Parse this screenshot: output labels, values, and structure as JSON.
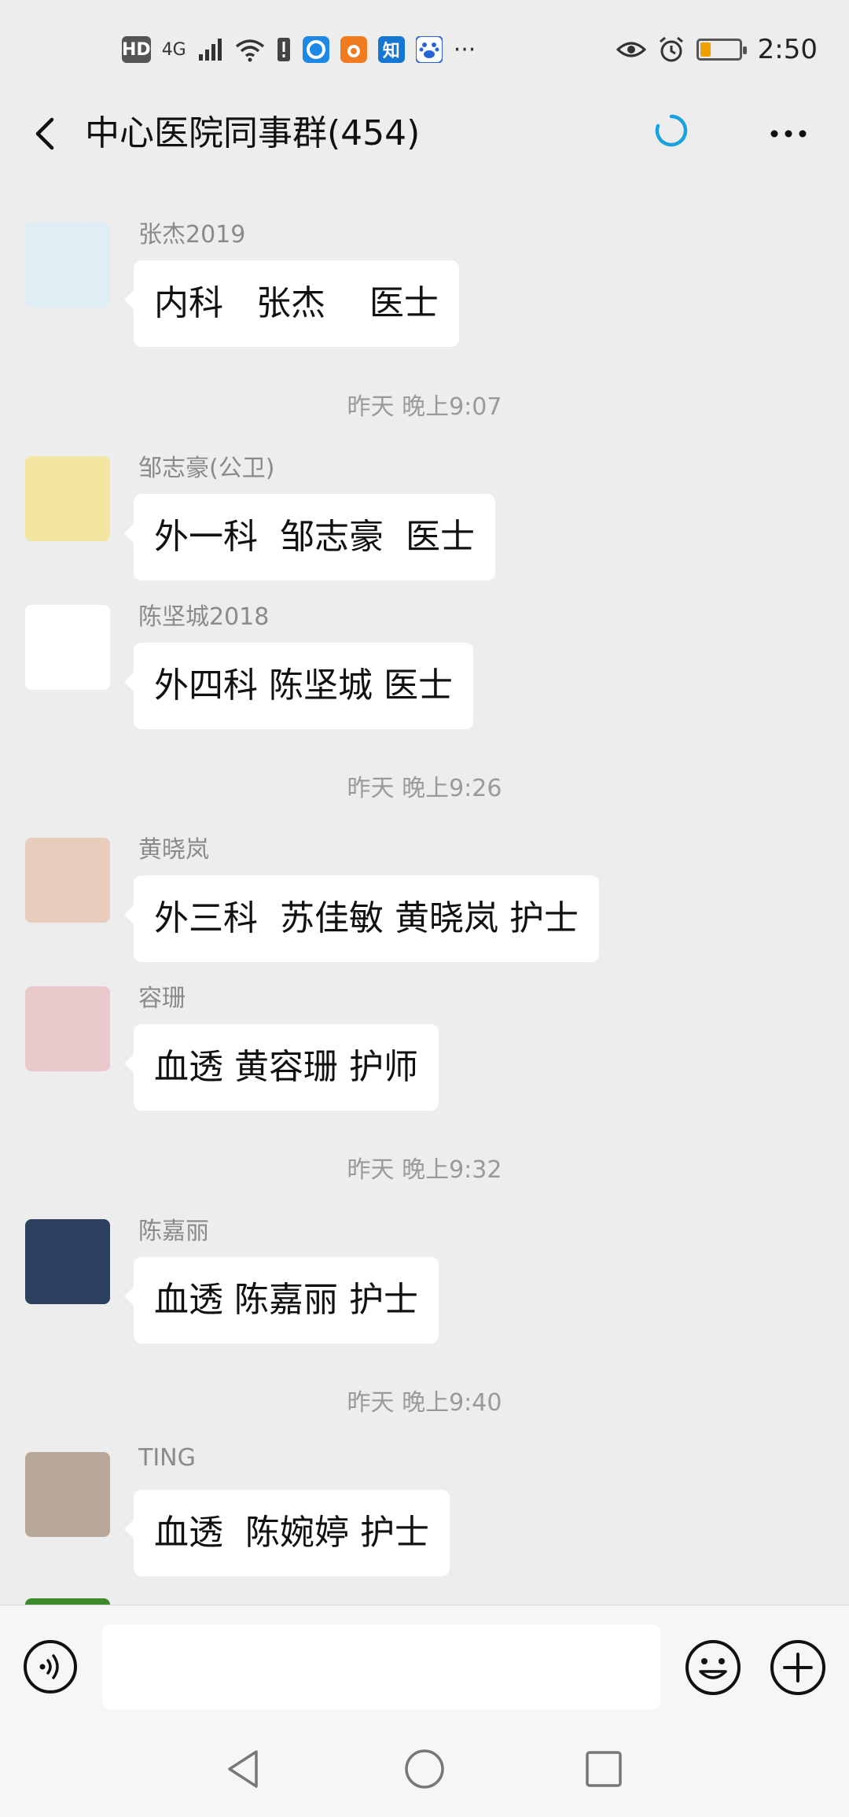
{
  "status_bar": {
    "hd": "HD",
    "network": "4G",
    "app_zhihu": "知",
    "more": "···",
    "time": "2:50",
    "battery_level": 0.25,
    "icons": [
      "signal-icon",
      "wifi-icon",
      "alert-icon",
      "browser-icon",
      "uc-icon",
      "zhihu-icon",
      "baidu-icon",
      "eye-icon",
      "alarm-icon",
      "battery-icon"
    ]
  },
  "header": {
    "title": "中心医院同事群(454)",
    "accent": "#1aa1e1"
  },
  "messages": [
    {
      "type": "message",
      "sender": "张杰2019",
      "text": "内科   张杰    医士",
      "avatar_color": "#dfeef5"
    },
    {
      "type": "time",
      "text": "昨天 晚上9:07"
    },
    {
      "type": "message",
      "sender": "邹志豪(公卫)",
      "text": "外一科  邹志豪  医士",
      "avatar_color": "#f3e6a0"
    },
    {
      "type": "message",
      "sender": "陈坚城2018",
      "text": "外四科 陈坚城 医士",
      "avatar_color": "#ffffff"
    },
    {
      "type": "time",
      "text": "昨天 晚上9:26"
    },
    {
      "type": "message",
      "sender": "黄晓岚",
      "text": "外三科  苏佳敏 黄晓岚 护士",
      "avatar_color": "#e8cdbd"
    },
    {
      "type": "message",
      "sender": "容珊",
      "text": "血透 黄容珊 护师",
      "avatar_color": "#e9c9cc"
    },
    {
      "type": "time",
      "text": "昨天 晚上9:32"
    },
    {
      "type": "message",
      "sender": "陈嘉丽",
      "text": "血透 陈嘉丽 护士",
      "avatar_color": "#2d3f5e"
    },
    {
      "type": "time",
      "text": "昨天 晚上9:40"
    },
    {
      "type": "message",
      "sender": "TING",
      "text": "血透  陈婉婷 护士",
      "avatar_color": "#b7a89a"
    }
  ],
  "input": {
    "value": "",
    "placeholder": ""
  }
}
